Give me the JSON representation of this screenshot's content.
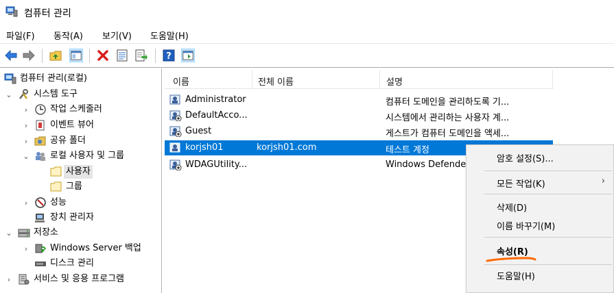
{
  "window": {
    "title": "컴퓨터 관리"
  },
  "menu": [
    "파일(F)",
    "동작(A)",
    "보기(V)",
    "도움말(H)"
  ],
  "toolbar_icons": [
    "back-icon",
    "forward-icon",
    "up-folder-icon",
    "show-tree-icon",
    "delete-icon",
    "properties-icon",
    "export-icon",
    "help-icon",
    "show-action-pane-icon"
  ],
  "tree": [
    {
      "label": "컴퓨터 관리(로컬)",
      "icon": "computer-management-icon"
    },
    {
      "label": "시스템 도구",
      "icon": "system-tools-icon"
    },
    {
      "label": "작업 스케줄러",
      "icon": "task-scheduler-icon"
    },
    {
      "label": "이벤트 뷰어",
      "icon": "event-viewer-icon"
    },
    {
      "label": "공유 폴더",
      "icon": "shared-folders-icon"
    },
    {
      "label": "로컬 사용자 및 그룹",
      "icon": "local-users-groups-icon"
    },
    {
      "label": "사용자",
      "icon": "folder-icon"
    },
    {
      "label": "그룹",
      "icon": "folder-icon"
    },
    {
      "label": "성능",
      "icon": "performance-icon"
    },
    {
      "label": "장치 관리자",
      "icon": "device-manager-icon"
    },
    {
      "label": "저장소",
      "icon": "storage-icon"
    },
    {
      "label": "Windows Server 백업",
      "icon": "server-backup-icon"
    },
    {
      "label": "디스크 관리",
      "icon": "disk-management-icon"
    },
    {
      "label": "서비스 및 응용 프로그램",
      "icon": "services-apps-icon"
    }
  ],
  "list": {
    "columns": [
      "이름",
      "전체 이름",
      "설명"
    ],
    "rows": [
      {
        "name": "Administrator",
        "full_name": "",
        "description": "컴퓨터 도메인을 관리하도록 기..."
      },
      {
        "name": "DefaultAcco...",
        "full_name": "",
        "description": "시스템에서 관리하는 사용자 계..."
      },
      {
        "name": "Guest",
        "full_name": "",
        "description": "게스트가 컴퓨터 도메인을 액세..."
      },
      {
        "name": "korjsh01",
        "full_name": "korjsh01.com",
        "description": "테스트 계정"
      },
      {
        "name": "WDAGUtility...",
        "full_name": "",
        "description": "Windows Defende"
      }
    ]
  },
  "context_menu": {
    "items": [
      "암호 설정(S)...",
      "모든 작업(K)",
      "삭제(D)",
      "이름 바꾸기(M)",
      "속성(R)",
      "도움말(H)"
    ],
    "submenu_arrow": "›",
    "highlight_color": "#ff6a00"
  }
}
